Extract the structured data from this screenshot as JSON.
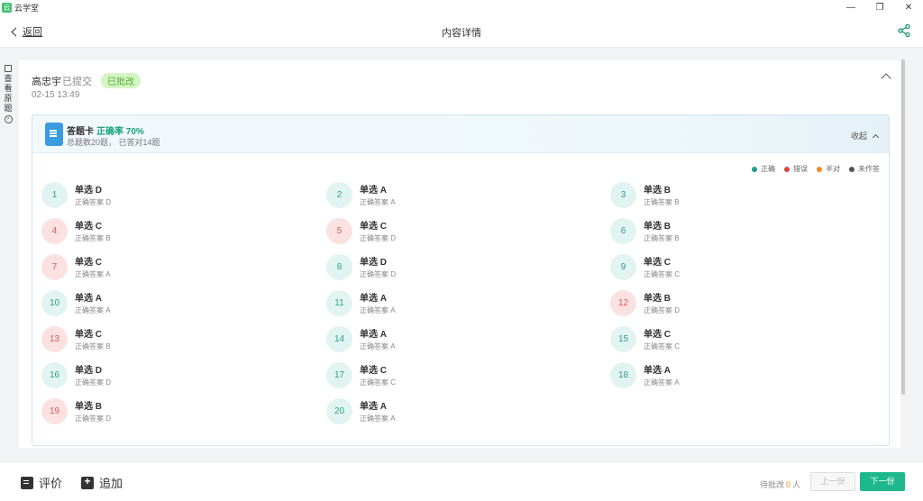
{
  "app": {
    "name": "云学堂"
  },
  "window": {
    "minimize_glyph": "—",
    "restore_glyph": "❐",
    "close_glyph": "✕"
  },
  "nav": {
    "back_label": "返回",
    "title": "内容详情",
    "share_icon": "share-icon"
  },
  "sidebar": {
    "label_chars": [
      "查",
      "看",
      "原",
      "题"
    ]
  },
  "submission": {
    "student_name": "高忠宇",
    "status": "已提交",
    "badge": "已批改",
    "time": "02-15 13:49"
  },
  "answer_card": {
    "title": "答题卡",
    "rate_label": "正确率 70%",
    "summary": "总题数20题， 已答对14题",
    "collapse_label": "收起"
  },
  "legend": [
    {
      "label": "正确",
      "color": "#17a085"
    },
    {
      "label": "错误",
      "color": "#e0463e"
    },
    {
      "label": "半对",
      "color": "#f08c1e"
    },
    {
      "label": "未作答",
      "color": "#555555"
    }
  ],
  "questions": [
    {
      "num": "1",
      "type": "单选 D",
      "answer": "正确答案 D",
      "status": "correct"
    },
    {
      "num": "2",
      "type": "单选 A",
      "answer": "正确答案 A",
      "status": "correct"
    },
    {
      "num": "3",
      "type": "单选 B",
      "answer": "正确答案 B",
      "status": "correct"
    },
    {
      "num": "4",
      "type": "单选 C",
      "answer": "正确答案 B",
      "status": "wrong"
    },
    {
      "num": "5",
      "type": "单选 C",
      "answer": "正确答案 D",
      "status": "wrong"
    },
    {
      "num": "6",
      "type": "单选 B",
      "answer": "正确答案 B",
      "status": "correct"
    },
    {
      "num": "7",
      "type": "单选 C",
      "answer": "正确答案 A",
      "status": "wrong"
    },
    {
      "num": "8",
      "type": "单选 D",
      "answer": "正确答案 D",
      "status": "correct"
    },
    {
      "num": "9",
      "type": "单选 C",
      "answer": "正确答案 C",
      "status": "correct"
    },
    {
      "num": "10",
      "type": "单选 A",
      "answer": "正确答案 A",
      "status": "correct"
    },
    {
      "num": "11",
      "type": "单选 A",
      "answer": "正确答案 A",
      "status": "correct"
    },
    {
      "num": "12",
      "type": "单选 B",
      "answer": "正确答案 D",
      "status": "wrong"
    },
    {
      "num": "13",
      "type": "单选 C",
      "answer": "正确答案 B",
      "status": "wrong"
    },
    {
      "num": "14",
      "type": "单选 A",
      "answer": "正确答案 A",
      "status": "correct"
    },
    {
      "num": "15",
      "type": "单选 C",
      "answer": "正确答案 C",
      "status": "correct"
    },
    {
      "num": "16",
      "type": "单选 D",
      "answer": "正确答案 D",
      "status": "correct"
    },
    {
      "num": "17",
      "type": "单选 C",
      "answer": "正确答案 C",
      "status": "correct"
    },
    {
      "num": "18",
      "type": "单选 A",
      "answer": "正确答案 A",
      "status": "correct"
    },
    {
      "num": "19",
      "type": "单选 B",
      "answer": "正确答案 D",
      "status": "wrong"
    },
    {
      "num": "20",
      "type": "单选 A",
      "answer": "正确答案 A",
      "status": "correct"
    }
  ],
  "bottom": {
    "comment_label": "评价",
    "append_label": "追加",
    "pending_prefix": "待批改",
    "pending_count": "0",
    "pending_suffix": "人",
    "prev_label": "上一份",
    "next_label": "下一份"
  }
}
